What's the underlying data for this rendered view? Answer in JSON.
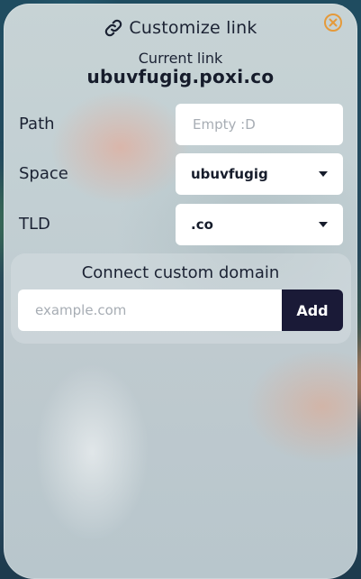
{
  "dialog": {
    "title": "Customize link",
    "title_icon": "link-icon",
    "close_icon": "close-icon"
  },
  "current_link": {
    "label": "Current link",
    "value": "ubuvfugig.poxi.co"
  },
  "path": {
    "label": "Path",
    "value": "",
    "placeholder": "Empty :D"
  },
  "space": {
    "label": "Space",
    "selected": "ubuvfugig",
    "icon": "caret-down-icon"
  },
  "tld": {
    "label": "TLD",
    "selected": ".co",
    "icon": "caret-down-icon"
  },
  "custom_domain": {
    "title": "Connect custom domain",
    "input_value": "",
    "placeholder": "example.com",
    "add_label": "Add"
  },
  "colors": {
    "accent_dark": "#1a1a37",
    "close_orange": "#e59a3a",
    "text": "#1b2233"
  }
}
